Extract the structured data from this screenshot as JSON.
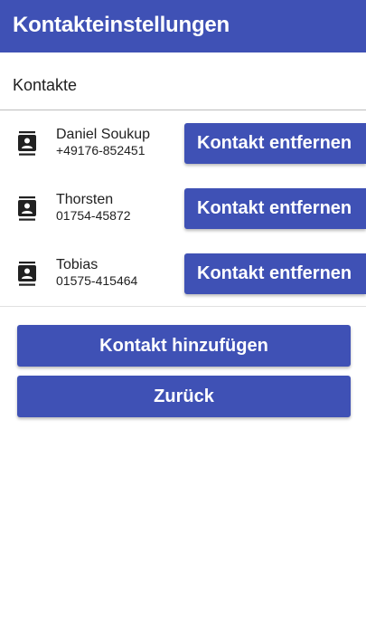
{
  "app_bar": {
    "title": "Kontakteinstellungen"
  },
  "section": {
    "title": "Kontakte"
  },
  "contacts": [
    {
      "name": "Daniel Soukup",
      "phone": "+49176-852451",
      "icon": "contact-card-icon",
      "remove_label": "Kontakt entfernen"
    },
    {
      "name": "Thorsten",
      "phone": "01754-45872",
      "icon": "contact-card-icon",
      "remove_label": "Kontakt entfernen"
    },
    {
      "name": "Tobias",
      "phone": "01575-415464",
      "icon": "contact-card-icon",
      "remove_label": "Kontakt entfernen"
    }
  ],
  "actions": {
    "add_label": "Kontakt hinzufügen",
    "back_label": "Zurück"
  },
  "colors": {
    "primary": "#3f51b5",
    "on_primary": "#ffffff",
    "text": "#212121"
  }
}
